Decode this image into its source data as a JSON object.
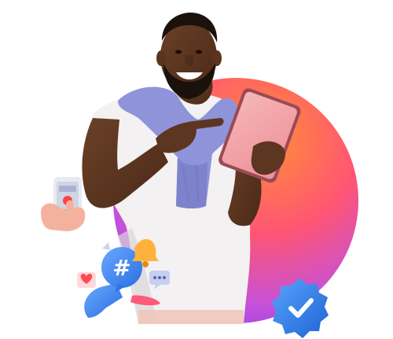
{
  "scene": {
    "alt_subject": "person",
    "colors": {
      "circle_top": "#ff7a2a",
      "circle_mid": "#ff4f6e",
      "circle_bottom": "#b23be0",
      "sweater": "#8f93d9",
      "shirt": "#f3f1f2",
      "tablet": "#f2a3a8",
      "hashtag_bubble": "#3d8bff",
      "bell": "#ffb23b",
      "verified_badge": "#2f7ee8",
      "heart": "#ff4b55"
    },
    "icons": [
      "phone-with-hand-icon",
      "hashtag-bubble-icon",
      "bell-icon",
      "heart-reaction-icon",
      "chat-bubble-icon",
      "verified-badge-icon",
      "tablet-icon"
    ]
  }
}
